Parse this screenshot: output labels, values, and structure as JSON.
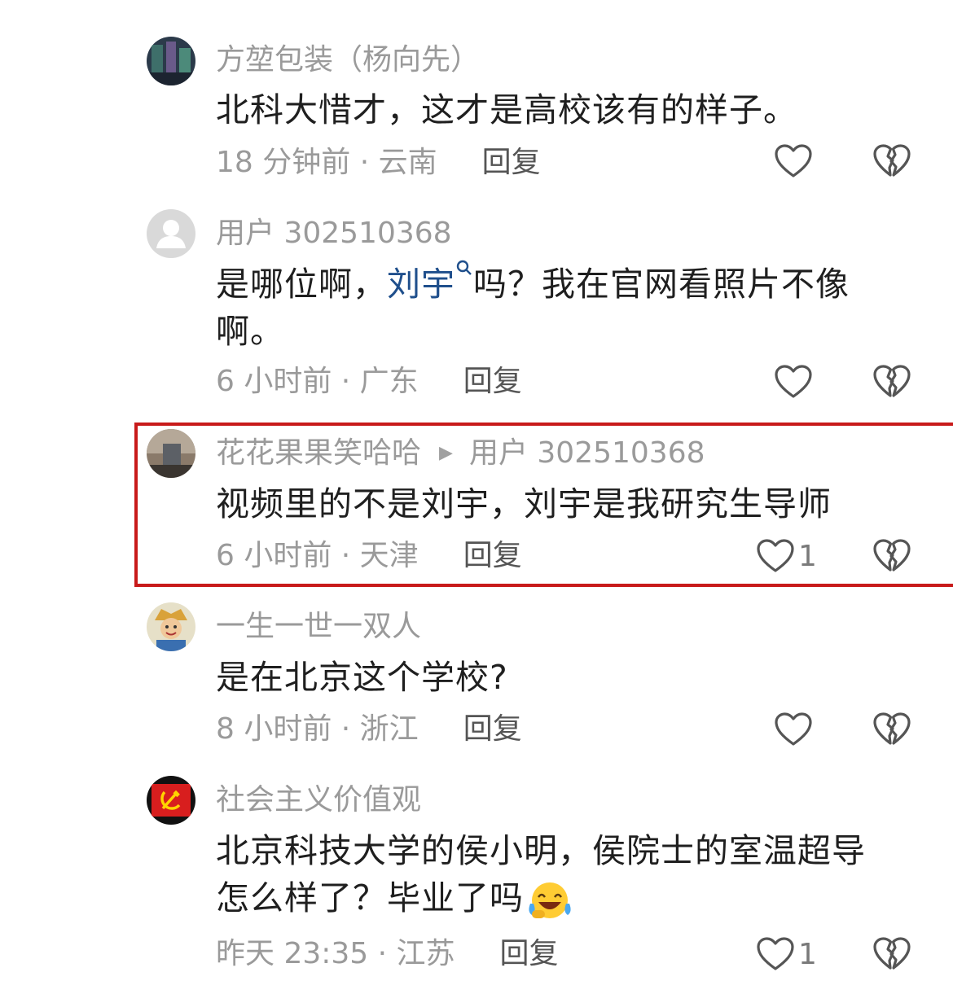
{
  "comments": [
    {
      "username": "方堃包装（杨向先）",
      "text": "北科大惜才，这才是高校该有的样子。",
      "time_location": "18 分钟前 · 云南",
      "reply_label": "回复",
      "like_count": ""
    },
    {
      "username": "用户 302510368",
      "text_before": "是哪位啊，",
      "mention": "刘宇",
      "text_after": "吗？我在官网看照片不像啊。",
      "time_location": "6 小时前 · 广东",
      "reply_label": "回复",
      "like_count": ""
    },
    {
      "username": "花花果果笑哈哈",
      "reply_to": "用户 302510368",
      "text": "视频里的不是刘宇，刘宇是我研究生导师",
      "time_location": "6 小时前 · 天津",
      "reply_label": "回复",
      "like_count": "1"
    },
    {
      "username": "一生一世一双人",
      "text": "是在北京这个学校?",
      "time_location": "8 小时前 · 浙江",
      "reply_label": "回复",
      "like_count": ""
    },
    {
      "username": "社会主义价值观",
      "text": "北京科技大学的侯小明，侯院士的室温超导怎么样了？毕业了吗",
      "time_location": "昨天 23:35 · 江苏",
      "reply_label": "回复",
      "like_count": "1"
    }
  ],
  "icons": {
    "like": "heart-outline-icon",
    "dislike": "broken-heart-icon",
    "mention": "search-icon",
    "emoji": "laughing-crying-emoji"
  },
  "colors": {
    "highlight_border": "#c81a1a",
    "mention_link": "#1f4f8c",
    "secondary_text": "#9a9a9a"
  }
}
